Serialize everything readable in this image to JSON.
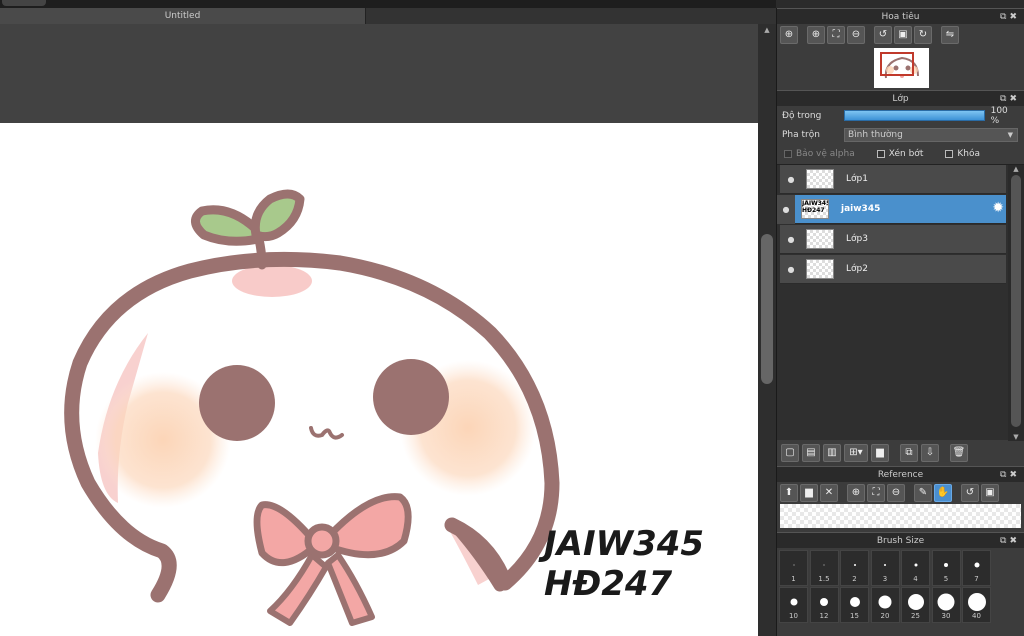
{
  "document": {
    "title": "Untitled"
  },
  "navigator": {
    "title": "Hoa tiêu"
  },
  "layer_panel": {
    "title": "Lớp",
    "opacity_label": "Độ trong",
    "opacity_value": "100 %",
    "blend_label": "Pha trộn",
    "blend_value": "Bình thường",
    "protect_alpha": "Bảo vệ alpha",
    "clipping": "Xén bớt",
    "lock": "Khóa",
    "layers": [
      {
        "name": "Lớp1",
        "thumb": ""
      },
      {
        "name": "jaiw345",
        "thumb": "JAIW345 HĐ247"
      },
      {
        "name": "Lớp3",
        "thumb": ""
      },
      {
        "name": "Lớp2",
        "thumb": ""
      }
    ]
  },
  "reference": {
    "title": "Reference"
  },
  "brush": {
    "title": "Brush Size",
    "sizes": [
      "1",
      "1.5",
      "2",
      "3",
      "4",
      "5",
      "7",
      "10",
      "12",
      "15",
      "20",
      "25",
      "30",
      "40"
    ],
    "dot_diameters": [
      1,
      1,
      2,
      2,
      3,
      4,
      5,
      7,
      8,
      10,
      13,
      16,
      17,
      18
    ]
  },
  "canvas_text": {
    "line1": "JAIW345",
    "line2": "HĐ247"
  },
  "colors": {
    "accent": "#4a90cc",
    "outline": "#9b7270",
    "blush": "#fcd3b4",
    "bow": "#f3a7a5",
    "leaf": "#a8c98c"
  }
}
